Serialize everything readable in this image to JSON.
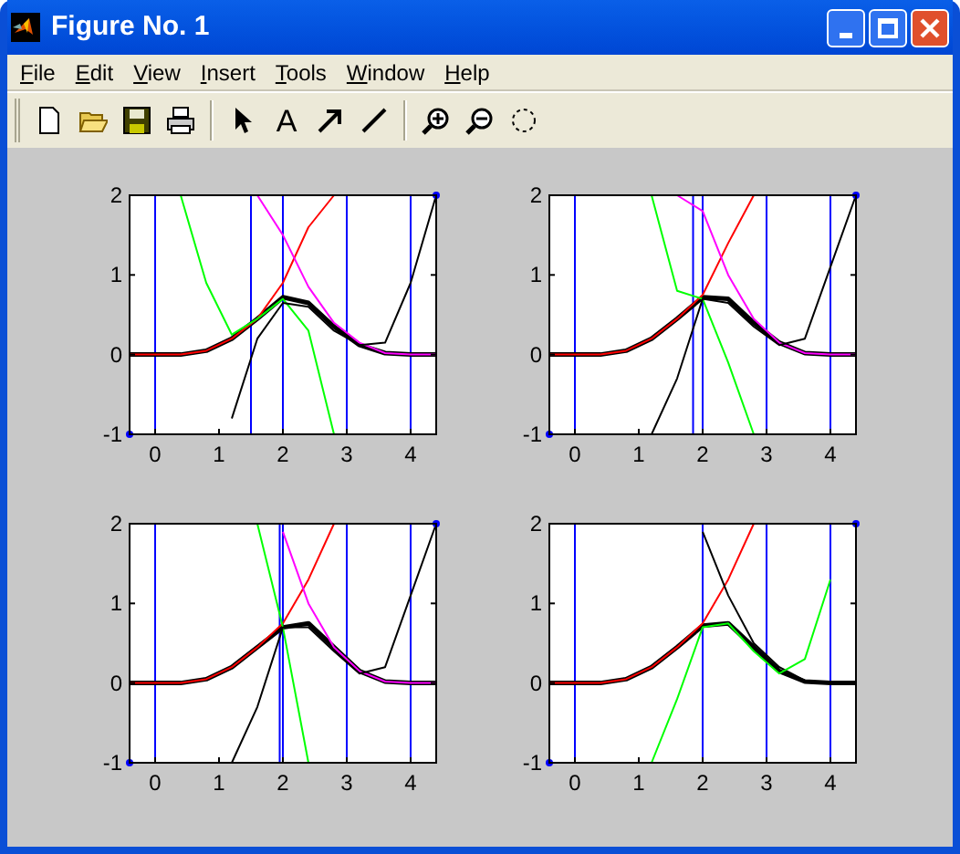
{
  "window": {
    "title": "Figure No. 1"
  },
  "menu": [
    "File",
    "Edit",
    "View",
    "Insert",
    "Tools",
    "Window",
    "Help"
  ],
  "toolbar": [
    {
      "kind": "new"
    },
    {
      "kind": "open"
    },
    {
      "kind": "save"
    },
    {
      "kind": "print"
    },
    {
      "kind": "separator"
    },
    {
      "kind": "pointer"
    },
    {
      "kind": "text",
      "label": "A"
    },
    {
      "kind": "arrow"
    },
    {
      "kind": "line"
    },
    {
      "kind": "separator"
    },
    {
      "kind": "zoom-in"
    },
    {
      "kind": "zoom-out"
    },
    {
      "kind": "rotate"
    }
  ],
  "plots": [
    {
      "chart_data": {
        "type": "line",
        "x": [
          -0.4,
          0,
          0.4,
          0.8,
          1.2,
          1.6,
          2.0,
          2.4,
          2.8,
          3.2,
          3.6,
          4.0,
          4.4
        ],
        "xlim": [
          -0.4,
          4.4
        ],
        "ylim": [
          -1,
          2
        ],
        "xticks": [
          0,
          1,
          2,
          3,
          4
        ],
        "yticks": [
          -1,
          0,
          1,
          2
        ],
        "series": [
          {
            "color": "#000000",
            "values": [
              0,
              0,
              0,
              0.05,
              0.2,
              0.45,
              0.72,
              0.65,
              0.35,
              0.12,
              0.02,
              0,
              0
            ]
          },
          {
            "color": "#ff0000",
            "values": [
              0,
              0,
              0,
              0.05,
              0.2,
              0.45,
              0.9,
              1.6,
              2.0,
              null,
              null,
              null,
              null
            ]
          },
          {
            "color": "#ff00ff",
            "values": [
              null,
              null,
              null,
              null,
              null,
              2.0,
              1.5,
              0.85,
              0.4,
              0.15,
              0.02,
              0,
              0
            ]
          },
          {
            "color": "#00ff00",
            "values": [
              null,
              null,
              2.0,
              0.9,
              0.25,
              0.45,
              0.7,
              0.3,
              -1.0,
              null,
              null,
              null,
              null
            ]
          },
          {
            "color": "#000000",
            "values": [
              null,
              null,
              null,
              null,
              -0.8,
              0.2,
              0.65,
              0.6,
              0.3,
              0.12,
              0.15,
              0.9,
              2.0
            ]
          },
          {
            "type": "scatter",
            "color": "#0000ff",
            "marker": "circle",
            "values": [
              -1,
              null,
              null,
              null,
              null,
              null,
              null,
              null,
              null,
              null,
              null,
              null,
              2
            ]
          }
        ],
        "ref_lines": [
          {
            "axis": "x",
            "value": 0,
            "color": "#0000ff"
          },
          {
            "axis": "x",
            "value": 1.5,
            "color": "#0000ff"
          },
          {
            "axis": "x",
            "value": 2,
            "color": "#0000ff"
          },
          {
            "axis": "x",
            "value": 3,
            "color": "#0000ff"
          },
          {
            "axis": "x",
            "value": 4,
            "color": "#0000ff"
          }
        ]
      }
    },
    {
      "chart_data": {
        "type": "line",
        "x": [
          -0.4,
          0,
          0.4,
          0.8,
          1.2,
          1.6,
          2.0,
          2.4,
          2.8,
          3.2,
          3.6,
          4.0,
          4.4
        ],
        "xlim": [
          -0.4,
          4.4
        ],
        "ylim": [
          -1,
          2
        ],
        "xticks": [
          0,
          1,
          2,
          3,
          4
        ],
        "yticks": [
          -1,
          0,
          1,
          2
        ],
        "series": [
          {
            "color": "#000000",
            "values": [
              0,
              0,
              0,
              0.05,
              0.2,
              0.45,
              0.72,
              0.7,
              0.4,
              0.15,
              0.02,
              0,
              0
            ]
          },
          {
            "color": "#ff0000",
            "values": [
              0,
              0,
              0,
              0.05,
              0.2,
              0.45,
              0.75,
              1.4,
              2.0,
              null,
              null,
              null,
              null
            ]
          },
          {
            "color": "#ff00ff",
            "values": [
              null,
              null,
              null,
              null,
              null,
              2.0,
              1.8,
              1.0,
              0.45,
              0.15,
              0.02,
              0,
              0
            ]
          },
          {
            "color": "#00ff00",
            "values": [
              null,
              null,
              null,
              null,
              2.0,
              0.8,
              0.7,
              -0.1,
              -1.0,
              null,
              null,
              null,
              null
            ]
          },
          {
            "color": "#000000",
            "values": [
              null,
              null,
              null,
              null,
              -1.0,
              -0.3,
              0.7,
              0.65,
              0.35,
              0.12,
              0.2,
              1.1,
              2.0
            ]
          },
          {
            "type": "scatter",
            "color": "#0000ff",
            "marker": "circle",
            "values": [
              -1,
              null,
              null,
              null,
              null,
              null,
              null,
              null,
              null,
              null,
              null,
              null,
              2
            ]
          }
        ],
        "ref_lines": [
          {
            "axis": "x",
            "value": 0,
            "color": "#0000ff"
          },
          {
            "axis": "x",
            "value": 1.85,
            "color": "#0000ff"
          },
          {
            "axis": "x",
            "value": 2,
            "color": "#0000ff"
          },
          {
            "axis": "x",
            "value": 3,
            "color": "#0000ff"
          },
          {
            "axis": "x",
            "value": 4,
            "color": "#0000ff"
          }
        ]
      }
    },
    {
      "chart_data": {
        "type": "line",
        "x": [
          -0.4,
          0,
          0.4,
          0.8,
          1.2,
          1.6,
          2.0,
          2.4,
          2.8,
          3.2,
          3.6,
          4.0,
          4.4
        ],
        "xlim": [
          -0.4,
          4.4
        ],
        "ylim": [
          -1,
          2
        ],
        "xticks": [
          0,
          1,
          2,
          3,
          4
        ],
        "yticks": [
          -1,
          0,
          1,
          2
        ],
        "series": [
          {
            "color": "#000000",
            "values": [
              0,
              0,
              0,
              0.05,
              0.2,
              0.45,
              0.7,
              0.75,
              0.45,
              0.15,
              0.02,
              0,
              0
            ]
          },
          {
            "color": "#ff0000",
            "values": [
              0,
              0,
              0,
              0.05,
              0.2,
              0.45,
              0.75,
              1.3,
              2.0,
              null,
              null,
              null,
              null
            ]
          },
          {
            "color": "#ff00ff",
            "values": [
              null,
              null,
              null,
              null,
              null,
              null,
              1.9,
              1.0,
              0.45,
              0.15,
              0.02,
              0,
              0
            ]
          },
          {
            "color": "#00ff00",
            "values": [
              null,
              null,
              null,
              null,
              null,
              2.0,
              0.7,
              -1.0,
              null,
              null,
              null,
              null,
              null
            ]
          },
          {
            "color": "#000000",
            "values": [
              null,
              null,
              null,
              null,
              -1.0,
              -0.3,
              0.7,
              0.7,
              0.4,
              0.12,
              0.2,
              1.1,
              2.0
            ]
          },
          {
            "type": "scatter",
            "color": "#0000ff",
            "marker": "circle",
            "values": [
              -1,
              null,
              null,
              null,
              null,
              null,
              null,
              null,
              null,
              null,
              null,
              null,
              2
            ]
          }
        ],
        "ref_lines": [
          {
            "axis": "x",
            "value": 0,
            "color": "#0000ff"
          },
          {
            "axis": "x",
            "value": 1.95,
            "color": "#0000ff"
          },
          {
            "axis": "x",
            "value": 2,
            "color": "#0000ff"
          },
          {
            "axis": "x",
            "value": 3,
            "color": "#0000ff"
          },
          {
            "axis": "x",
            "value": 4,
            "color": "#0000ff"
          }
        ]
      }
    },
    {
      "chart_data": {
        "type": "line",
        "x": [
          -0.4,
          0,
          0.4,
          0.8,
          1.2,
          1.6,
          2.0,
          2.4,
          2.8,
          3.2,
          3.6,
          4.0,
          4.4
        ],
        "xlim": [
          -0.4,
          4.4
        ],
        "ylim": [
          -1,
          2
        ],
        "xticks": [
          0,
          1,
          2,
          3,
          4
        ],
        "yticks": [
          -1,
          0,
          1,
          2
        ],
        "series": [
          {
            "color": "#000000",
            "values": [
              0,
              0,
              0,
              0.05,
              0.2,
              0.45,
              0.72,
              0.75,
              0.45,
              0.15,
              0.02,
              0,
              0
            ]
          },
          {
            "color": "#ff0000",
            "values": [
              0,
              0,
              0,
              0.05,
              0.2,
              0.45,
              0.75,
              1.3,
              2.0,
              null,
              null,
              null,
              null
            ]
          },
          {
            "color": "#000000",
            "values": [
              null,
              null,
              null,
              null,
              null,
              null,
              1.9,
              1.1,
              0.5,
              0.2,
              0.03,
              0,
              0
            ]
          },
          {
            "color": "#00ff00",
            "values": [
              null,
              null,
              null,
              null,
              -1.0,
              -0.2,
              0.7,
              0.75,
              0.4,
              0.12,
              0.3,
              1.3,
              null
            ]
          },
          {
            "type": "scatter",
            "color": "#0000ff",
            "marker": "circle",
            "values": [
              -1,
              null,
              null,
              null,
              null,
              null,
              null,
              null,
              null,
              null,
              null,
              null,
              2
            ]
          }
        ],
        "ref_lines": [
          {
            "axis": "x",
            "value": 0,
            "color": "#0000ff"
          },
          {
            "axis": "x",
            "value": 2,
            "color": "#0000ff"
          },
          {
            "axis": "x",
            "value": 3,
            "color": "#0000ff"
          },
          {
            "axis": "x",
            "value": 4,
            "color": "#0000ff"
          }
        ]
      }
    }
  ]
}
